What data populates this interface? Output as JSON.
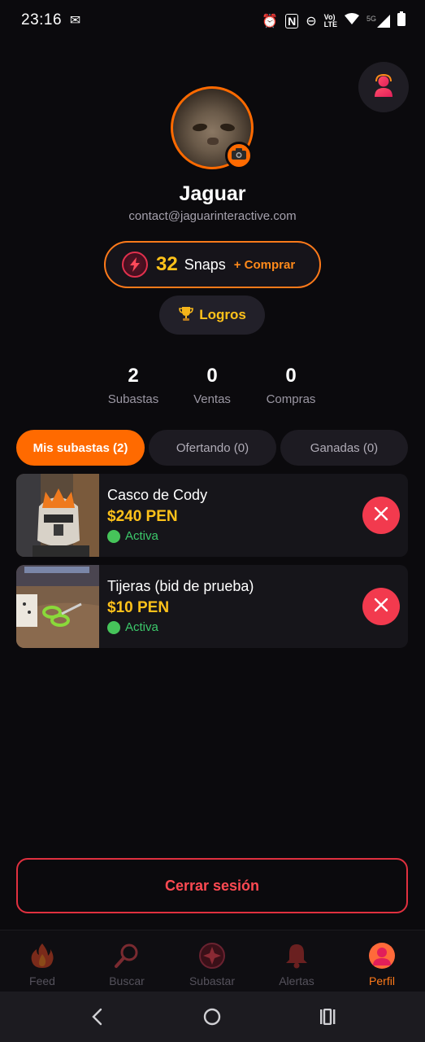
{
  "status_bar": {
    "time": "23:16",
    "network_label": "5G"
  },
  "profile": {
    "name": "Jaguar",
    "email": "contact@jaguarinteractive.com"
  },
  "snaps": {
    "count": "32",
    "label": "Snaps",
    "buy_label": "+ Comprar"
  },
  "achievements": {
    "label": "Logros"
  },
  "stats": [
    {
      "value": "2",
      "label": "Subastas"
    },
    {
      "value": "0",
      "label": "Ventas"
    },
    {
      "value": "0",
      "label": "Compras"
    }
  ],
  "tabs": [
    {
      "label": "Mis subastas (2)",
      "active": true
    },
    {
      "label": "Ofertando (0)",
      "active": false
    },
    {
      "label": "Ganadas (0)",
      "active": false
    }
  ],
  "auctions": [
    {
      "title": "Casco de Cody",
      "price": "$240 PEN",
      "status": "Activa"
    },
    {
      "title": "Tijeras (bid de prueba)",
      "price": "$10 PEN",
      "status": "Activa"
    }
  ],
  "logout_label": "Cerrar sesión",
  "bottom_nav": [
    {
      "label": "Feed",
      "icon": "flame-icon",
      "active": false
    },
    {
      "label": "Buscar",
      "icon": "search-icon",
      "active": false
    },
    {
      "label": "Subastar",
      "icon": "auction-icon",
      "active": false
    },
    {
      "label": "Alertas",
      "icon": "bell-icon",
      "active": false
    },
    {
      "label": "Perfil",
      "icon": "profile-icon",
      "active": true
    }
  ],
  "colors": {
    "accent": "#ff6a00",
    "gold": "#ffc21a",
    "danger": "#f23a4e",
    "active_green": "#3cc96b",
    "background": "#0b0a0d"
  }
}
